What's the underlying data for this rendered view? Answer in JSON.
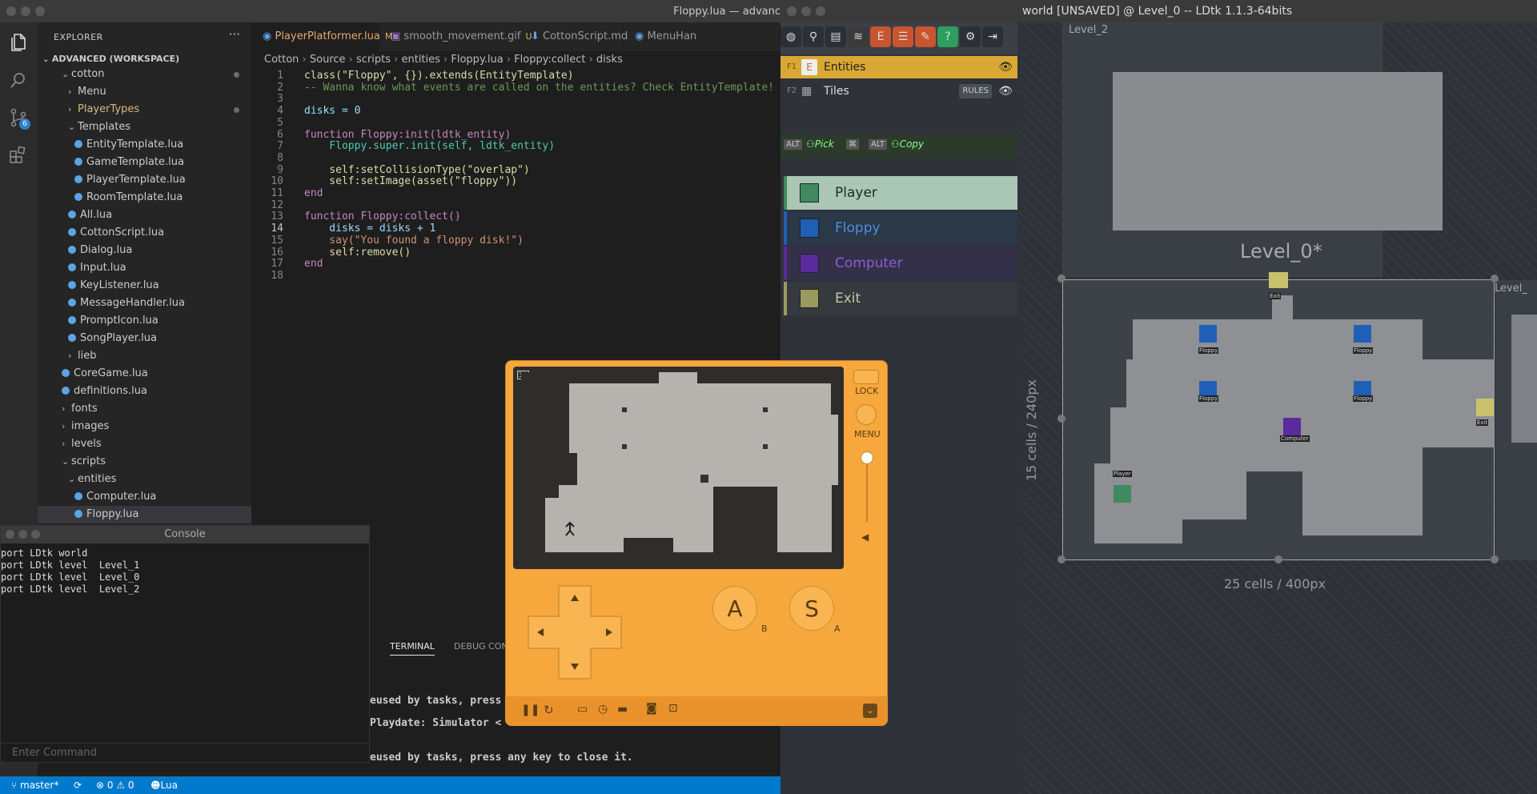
{
  "vscode": {
    "window_title": "Floppy.lua — advanc",
    "explorer": {
      "header": "EXPLORER",
      "more": "···",
      "workspace": "ADVANCED (WORKSPACE)",
      "items": [
        {
          "label": "cotton",
          "indent": 2,
          "type": "folder-open",
          "mod": true
        },
        {
          "label": "Menu",
          "indent": 3,
          "type": "folder"
        },
        {
          "label": "PlayerTypes",
          "indent": 3,
          "type": "folder",
          "mod": true,
          "orange": true
        },
        {
          "label": "Templates",
          "indent": 3,
          "type": "folder-open"
        },
        {
          "label": "EntityTemplate.lua",
          "indent": 4,
          "type": "file"
        },
        {
          "label": "GameTemplate.lua",
          "indent": 4,
          "type": "file"
        },
        {
          "label": "PlayerTemplate.lua",
          "indent": 4,
          "type": "file"
        },
        {
          "label": "RoomTemplate.lua",
          "indent": 4,
          "type": "file"
        },
        {
          "label": "All.lua",
          "indent": 3,
          "type": "file"
        },
        {
          "label": "CottonScript.lua",
          "indent": 3,
          "type": "file"
        },
        {
          "label": "Dialog.lua",
          "indent": 3,
          "type": "file"
        },
        {
          "label": "Input.lua",
          "indent": 3,
          "type": "file"
        },
        {
          "label": "KeyListener.lua",
          "indent": 3,
          "type": "file"
        },
        {
          "label": "MessageHandler.lua",
          "indent": 3,
          "type": "file"
        },
        {
          "label": "PromptIcon.lua",
          "indent": 3,
          "type": "file"
        },
        {
          "label": "SongPlayer.lua",
          "indent": 3,
          "type": "file"
        },
        {
          "label": "lieb",
          "indent": 3,
          "type": "folder"
        },
        {
          "label": "CoreGame.lua",
          "indent": 2,
          "type": "file"
        },
        {
          "label": "definitions.lua",
          "indent": 2,
          "type": "file"
        },
        {
          "label": "fonts",
          "indent": 2,
          "type": "folder"
        },
        {
          "label": "images",
          "indent": 2,
          "type": "folder"
        },
        {
          "label": "levels",
          "indent": 2,
          "type": "folder"
        },
        {
          "label": "scripts",
          "indent": 2,
          "type": "folder-open"
        },
        {
          "label": "entities",
          "indent": 3,
          "type": "folder-open"
        },
        {
          "label": "Computer.lua",
          "indent": 4,
          "type": "file"
        },
        {
          "label": "Floppy.lua",
          "indent": 4,
          "type": "file",
          "selected": true
        }
      ]
    },
    "tabs": [
      {
        "label": "PlayerPlatformer.lua",
        "badge": "M",
        "active": true,
        "icon": "lua"
      },
      {
        "label": "smooth_movement.gif",
        "badge": "U",
        "icon": "image"
      },
      {
        "label": "CottonScript.md",
        "badge": "",
        "icon": "markdown"
      },
      {
        "label": "MenuHan",
        "badge": "",
        "icon": "lua"
      }
    ],
    "breadcrumbs": [
      "Cotton",
      "Source",
      "scripts",
      "entities",
      "Floppy.lua",
      "Floppy:collect",
      "disks"
    ],
    "code_lines": [
      {
        "n": "1",
        "t": "class(\"Floppy\", {}).extends(EntityTemplate)"
      },
      {
        "n": "2",
        "t": "-- Wanna know what events are called on the entities? Check EntityTemplate!"
      },
      {
        "n": "3",
        "t": ""
      },
      {
        "n": "4",
        "t": "disks = 0"
      },
      {
        "n": "5",
        "t": ""
      },
      {
        "n": "6",
        "t": "function Floppy:init(ldtk_entity)"
      },
      {
        "n": "7",
        "t": "    Floppy.super.init(self, ldtk_entity)"
      },
      {
        "n": "8",
        "t": ""
      },
      {
        "n": "9",
        "t": "    self:setCollisionType(\"overlap\")"
      },
      {
        "n": "10",
        "t": "    self:setImage(asset(\"floppy\"))"
      },
      {
        "n": "11",
        "t": "end"
      },
      {
        "n": "12",
        "t": ""
      },
      {
        "n": "13",
        "t": "function Floppy:collect()"
      },
      {
        "n": "14",
        "t": "    disks = disks + 1"
      },
      {
        "n": "15",
        "t": "    say(\"You found a floppy disk!\")"
      },
      {
        "n": "16",
        "t": "    self:remove()"
      },
      {
        "n": "17",
        "t": "end"
      },
      {
        "n": "18",
        "t": ""
      }
    ],
    "panel_tabs": [
      "TERMINAL",
      "DEBUG CON"
    ],
    "terminal_lines": [
      "eused by tasks, press any",
      "Playdate: Simulator <",
      "eused by tasks, press any key to close it."
    ],
    "status": {
      "branch": "master*",
      "errors": "0",
      "warnings": "0",
      "language": "Lua",
      "scm_badge": "6"
    }
  },
  "console": {
    "title": "Console",
    "lines": [
      "port LDtk world",
      "port LDtk level  Level_1",
      "port LDtk level  Level_0",
      "port LDtk level  Level_2"
    ],
    "placeholder": "Enter Command"
  },
  "ldtk": {
    "title": "world [UNSAVED] @ Level_0  --  LDtk 1.1.3-64bits",
    "layers": [
      {
        "key": "F1",
        "label": "Entities",
        "badge": "E",
        "active": true
      },
      {
        "key": "F2",
        "label": "Tiles",
        "badge": "",
        "rules": "RULES"
      }
    ],
    "pick_hint": {
      "alt": "ALT",
      "pick": "Pick",
      "cmd": "⌘",
      "alt2": "ALT",
      "copy": "Copy"
    },
    "entities": [
      {
        "label": "Player",
        "color": "#3f8a5f",
        "selected": true
      },
      {
        "label": "Floppy",
        "color": "#1f5fb8"
      },
      {
        "label": "Computer",
        "color": "#5b2a9c"
      },
      {
        "label": "Exit",
        "color": "#9a9a5f"
      }
    ],
    "canvas": {
      "level_top": "Level_2",
      "level_main": "Level_0*",
      "level_right": "Level_",
      "height_label": "15 cells / 240px",
      "width_label": "25 cells / 400px",
      "entity_tags": [
        "Exit",
        "Floppy",
        "Floppy",
        "Floppy",
        "Floppy",
        "Computer",
        "Exit",
        "Player"
      ]
    }
  },
  "playdate": {
    "screen_badge": "3D",
    "lock": "LOCK",
    "menu": "MENU",
    "btn_a": "A",
    "btn_a_sub": "B",
    "btn_s": "S",
    "btn_s_sub": "A"
  }
}
